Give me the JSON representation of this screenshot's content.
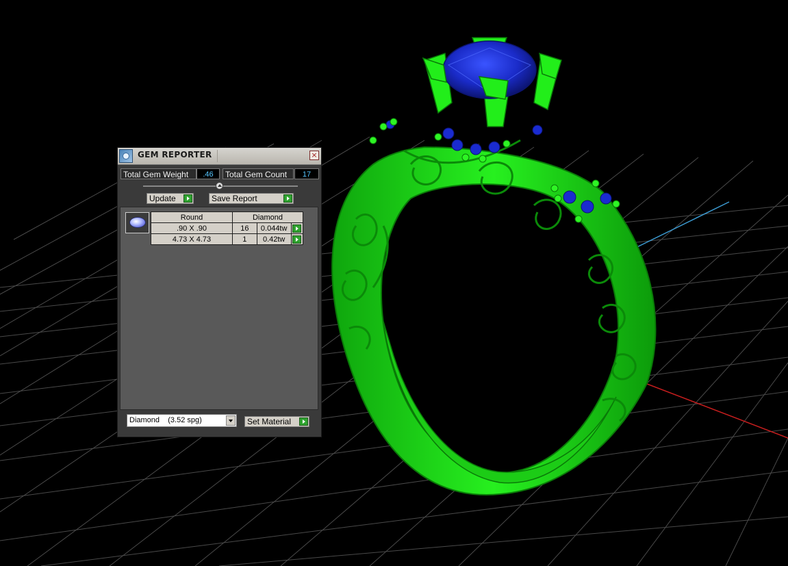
{
  "panel": {
    "title": "GEM REPORTER",
    "close_label": "×",
    "total_weight_label": "Total Gem Weight",
    "total_weight_value": ".46",
    "total_count_label": "Total Gem Count",
    "total_count_value": "17",
    "update_label": "Update",
    "save_report_label": "Save Report",
    "table": {
      "headers": [
        "Round",
        "Diamond"
      ],
      "rows": [
        {
          "size": ".90 X .90",
          "count": "16",
          "weight": "0.044tw"
        },
        {
          "size": "4.73 X 4.73",
          "count": "1",
          "weight": "0.42tw"
        }
      ]
    },
    "material_select": "Diamond    (3.52 spg)",
    "set_material_label": "Set Material"
  },
  "colors": {
    "metal": "#22ee1a",
    "gem": "#1a2bd0",
    "grid": "#4a4a4a",
    "axis_x": "#c81e1e",
    "axis_y": "#3c9bd2"
  },
  "icons": [
    "gem-reporter-icon",
    "close-icon",
    "slider-knob-icon",
    "play-arrow-icon",
    "round-gem-icon",
    "dropdown-arrow-icon"
  ]
}
